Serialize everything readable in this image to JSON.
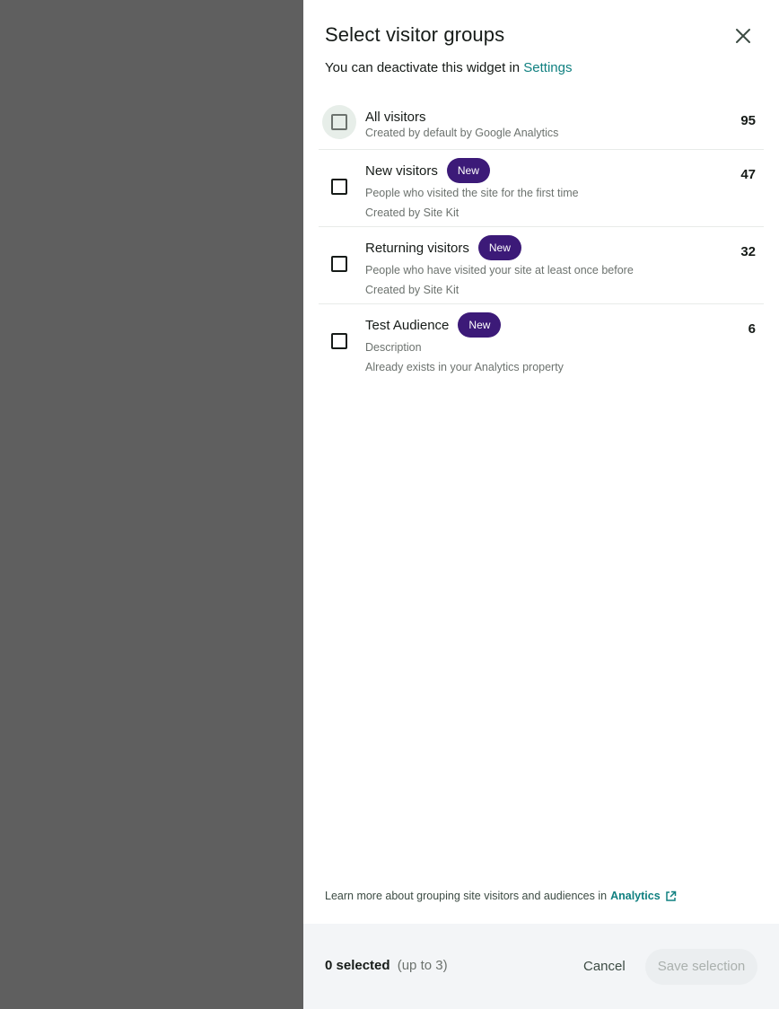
{
  "dialog": {
    "title": "Select visitor groups",
    "subtitle_prefix": "You can deactivate this widget in",
    "subtitle_link": "Settings"
  },
  "groups": [
    {
      "name": "All visitors",
      "badge": "",
      "description": "Created by default by Google Analytics",
      "source": "",
      "count": "95",
      "checked": false
    },
    {
      "name": "New visitors",
      "badge": "New",
      "description": "People who visited the site for the first time",
      "source": "Created by Site Kit",
      "count": "47",
      "checked": false
    },
    {
      "name": "Returning visitors",
      "badge": "New",
      "description": "People who have visited your site at least once before",
      "source": "Created by Site Kit",
      "count": "32",
      "checked": false
    },
    {
      "name": "Test Audience",
      "badge": "New",
      "description": "Description",
      "source": "Already exists in your Analytics property",
      "count": "6",
      "checked": false
    }
  ],
  "learn_more": {
    "text": "Learn more about grouping site visitors and audiences in",
    "link": "Analytics"
  },
  "footer": {
    "selected": "0 selected",
    "limit": "(up to 3)",
    "cancel": "Cancel",
    "save": "Save selection"
  },
  "colors": {
    "accent": "#108080",
    "badge": "#3c1a78",
    "backdrop": "#5f5f5f",
    "footer_bg": "#f3f5f7"
  },
  "icons": {
    "close": "close-icon",
    "external": "external-link-icon"
  }
}
